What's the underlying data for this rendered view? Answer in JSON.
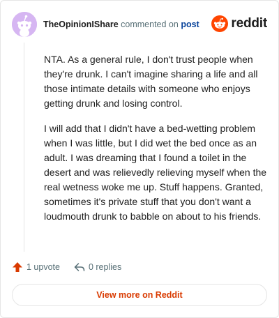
{
  "header": {
    "username": "TheOpinionIShare",
    "action_text": "commented on",
    "target_text": "post",
    "brand": "reddit"
  },
  "comment": {
    "paragraphs": [
      "NTA. As a general rule, I don't trust people when they're drunk. I can't imagine sharing a life and all those intimate details with someone who enjoys getting drunk and losing control.",
      "I will add that I didn't have a bed-wetting problem when I was little, but I did wet the bed once as an adult. I was dreaming that I found a toilet in the desert and was relievedly relieving myself when the real wetness woke me up. Stuff happens. Granted, sometimes it's private stuff that you don't want a loudmouth drunk to babble on about to his friends."
    ]
  },
  "actions": {
    "upvotes_label": "1 upvote",
    "replies_label": "0 replies"
  },
  "cta": {
    "label": "View more on Reddit"
  },
  "colors": {
    "brand_orange": "#ff4500",
    "cta_text": "#d93a00",
    "avatar_bg": "#d6b6f2",
    "link_blue": "#0a449b",
    "muted": "#576f76",
    "border": "#e5e5e5"
  },
  "icons": {
    "avatar": "snoo-avatar-icon",
    "logo": "reddit-logo-icon",
    "upvote": "upvote-arrow-icon",
    "reply": "reply-arrow-icon"
  }
}
